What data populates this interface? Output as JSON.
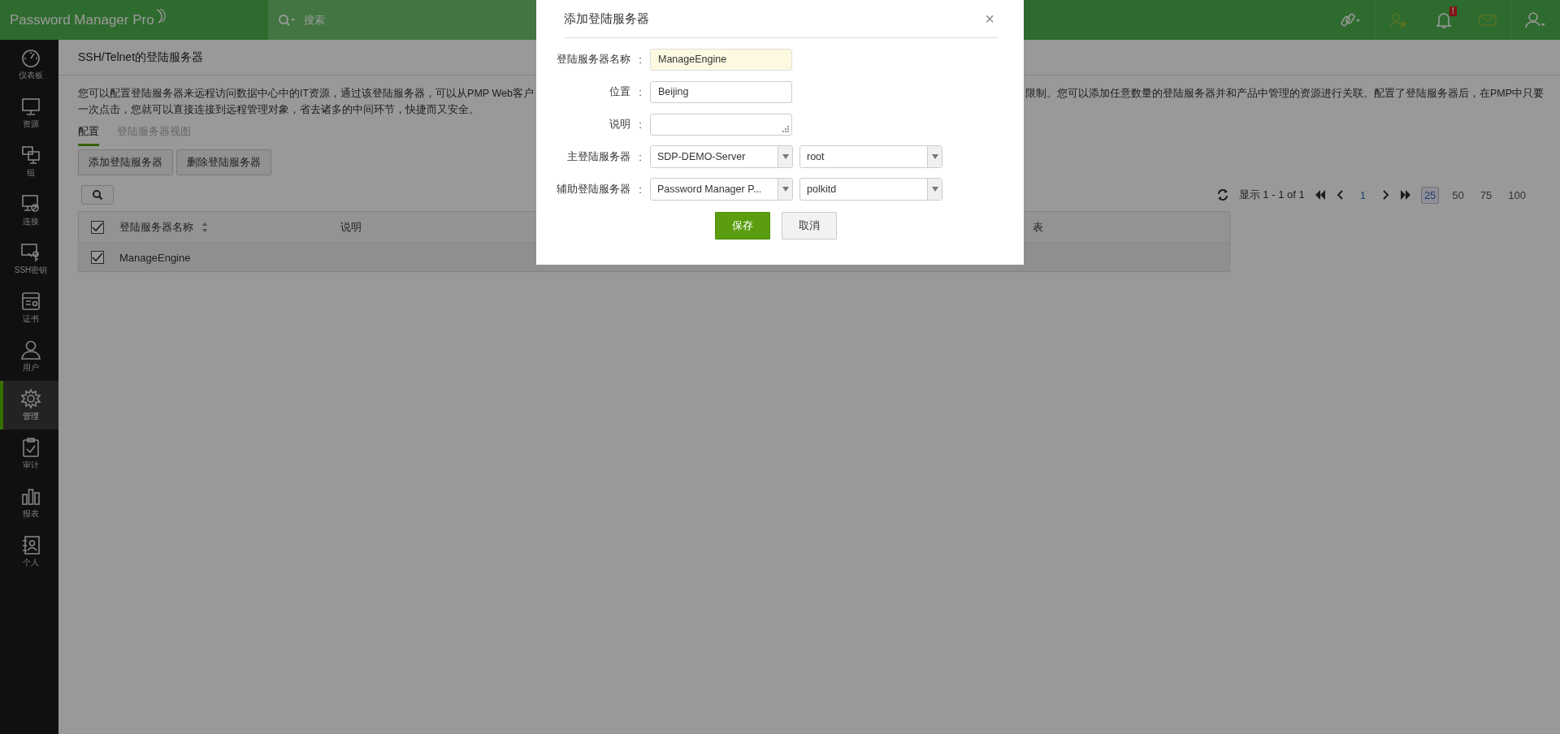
{
  "topbar": {
    "logo": "Password Manager Pro",
    "search_placeholder": "搜索",
    "notification_badge": "!"
  },
  "sidebar": {
    "items": [
      {
        "label": "仪表板",
        "kind": "gauge",
        "selected": false
      },
      {
        "label": "资源",
        "kind": "monitor",
        "selected": false
      },
      {
        "label": "组",
        "kind": "group",
        "selected": false
      },
      {
        "label": "连接",
        "kind": "connect",
        "selected": false
      },
      {
        "label": "SSH密钥",
        "kind": "key",
        "selected": false
      },
      {
        "label": "证书",
        "kind": "certificate",
        "selected": false
      },
      {
        "label": "用户",
        "kind": "user",
        "selected": false
      },
      {
        "label": "管理",
        "kind": "gear",
        "selected": true
      },
      {
        "label": "审计",
        "kind": "clipboard",
        "selected": false
      },
      {
        "label": "报表",
        "kind": "chart",
        "selected": false
      },
      {
        "label": "个人",
        "kind": "contact",
        "selected": false
      }
    ]
  },
  "page": {
    "title": "SSH/Telnet的登陆服务器",
    "description": {
      "line1_left": "您可以配置登陆服务器来远程访问数据中心中的IT资源，通过该登陆服务器，可以从PMP Web客户",
      "line1_right": "限制。您可以添加任意数量的登陆服务器并和产品中管理的资源进行关联。配置了登陆服务器后，在PMP中只要",
      "line2": "一次点击，您就可以直接连接到远程管理对象，省去诸多的中间环节，快捷而又安全。"
    },
    "tabs": [
      {
        "label": "配置",
        "selected": true
      },
      {
        "label": "登陆服务器视图",
        "selected": false
      }
    ],
    "buttons": [
      "添加登陆服务器",
      "删除登陆服务器"
    ],
    "pager": {
      "summary": "显示 1 - 1 of 1",
      "page": "1",
      "page_sizes": [
        {
          "label": "25",
          "selected": true
        },
        {
          "label": "50",
          "selected": false
        },
        {
          "label": "75",
          "selected": false
        },
        {
          "label": "100",
          "selected": false
        }
      ]
    },
    "table": {
      "header_checked": true,
      "columns": [
        {
          "label": "登陆服务器名称",
          "sortable": true
        },
        {
          "label": "说明",
          "sortable": false
        },
        {
          "label": "表",
          "sortable": false
        }
      ],
      "rows": [
        {
          "checked": true,
          "cells": [
            "ManageEngine"
          ]
        }
      ]
    }
  },
  "dialog": {
    "title": "添加登陆服务器",
    "close": "×",
    "fields": [
      {
        "kind": "text",
        "label": "登陆服务器名称",
        "separator": ":",
        "value": "ManageEngine",
        "focused": true
      },
      {
        "kind": "text",
        "label": "位置",
        "separator": ":",
        "value": "Beijing",
        "focused": false
      },
      {
        "kind": "textarea",
        "label": "说明",
        "separator": ":",
        "focused": false
      },
      {
        "kind": "select-pair",
        "label": "主登陆服务器",
        "separator": ":",
        "values": [
          "SDP-DEMO-Server",
          "root"
        ]
      },
      {
        "kind": "select-pair",
        "label": "辅助登陆服务器",
        "separator": ":",
        "values": [
          "Password Manager P...",
          "polkitd"
        ]
      }
    ],
    "buttons": [
      {
        "label": "保存",
        "kind": "primary"
      },
      {
        "label": "取消",
        "kind": "secondary"
      }
    ]
  }
}
